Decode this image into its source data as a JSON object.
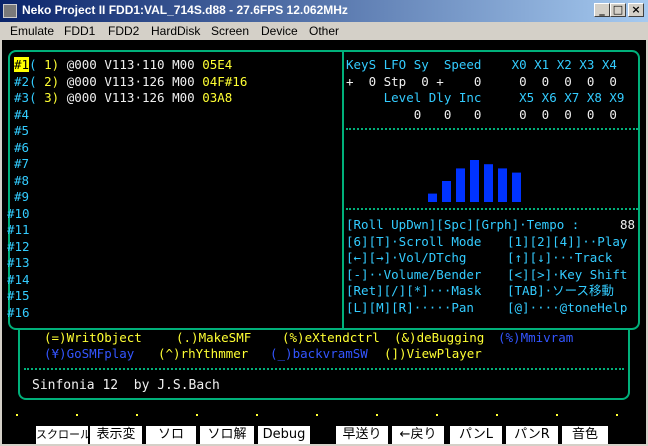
{
  "window": {
    "title": "Neko Project II  FDD1:VAL_714S.d88 - 27.6FPS 12.062MHz",
    "minimize": "_",
    "maximize": "□",
    "close": "×"
  },
  "menu": [
    "Emulate",
    "FDD1",
    "FDD2",
    "HardDisk",
    "Screen",
    "Device",
    "Other"
  ],
  "channels": [
    {
      "id": "#1",
      "paren": "(",
      "num": "1)",
      "info": "@000 V113·110 M00",
      "note": "05E4"
    },
    {
      "id": "#2",
      "paren": "(",
      "num": "2)",
      "info": "@000 V113·126 M00",
      "note": "04F#16"
    },
    {
      "id": "#3",
      "paren": "(",
      "num": "3)",
      "info": "@000 V113·126 M00",
      "note": "03A8"
    },
    {
      "id": "#4"
    },
    {
      "id": "#5"
    },
    {
      "id": "#6"
    },
    {
      "id": "#7"
    },
    {
      "id": "#8"
    },
    {
      "id": "#9"
    },
    {
      "id": "#10"
    },
    {
      "id": "#11"
    },
    {
      "id": "#12"
    },
    {
      "id": "#13"
    },
    {
      "id": "#14"
    },
    {
      "id": "#15"
    },
    {
      "id": "#16"
    }
  ],
  "params": {
    "row1_labels": "KeyS LFO Sy  Speed    X0 X1 X2 X3 X4",
    "row1_values": "+  0 Stp  0 +    0     0  0  0  0  0",
    "row2_labels": "     Level Dly Inc     X5 X6 X7 X8 X9",
    "row2_values": "         0   0   0     0  0  0  0  0"
  },
  "spectrum": [
    2,
    5,
    8,
    10,
    9,
    8,
    7,
    5
  ],
  "help": [
    {
      "key": "[Roll UpDwn][Spc][Grph]·Tempo :",
      "val": "88"
    },
    {
      "key": "[6][T]·Scroll Mode",
      "val": "[1][2][4]]··Play"
    },
    {
      "key": "[←][→]·Vol/DTchg",
      "val": "[↑][↓]···Track"
    },
    {
      "key": "[-]··Volume/Bender",
      "val": "[<][>]·Key Shift"
    },
    {
      "key": "[Ret][/][*]···Mask",
      "val": "[TAB]·ソース移動"
    },
    {
      "key": "[L][M][R]·····Pan",
      "val": "[@]····@toneHelp"
    }
  ],
  "commands": {
    "row1": [
      {
        "text": "(=)WritObject",
        "color": "#ffff33"
      },
      {
        "text": "(.)MakeSMF",
        "color": "#ffff33"
      },
      {
        "text": "(%)eXtendctrl",
        "color": "#ffff33"
      },
      {
        "text": "(&)deBugging",
        "color": "#ffff33"
      },
      {
        "text": "(%)Mmivram",
        "color": "#3355ff"
      }
    ],
    "row2": [
      {
        "text": "(¥)GoSMFplay",
        "color": "#3355ff"
      },
      {
        "text": "(^)rhYthmmer",
        "color": "#ffff33"
      },
      {
        "text": "(_)backvramSW",
        "color": "#3355ff"
      },
      {
        "text": "(])ViewPlayer",
        "color": "#ffff33"
      }
    ]
  },
  "song_title": "Sinfonia 12  by J.S.Bach",
  "fkeys": [
    "スクロール",
    "表示変",
    "ソロ",
    "ソロ解",
    "Debug",
    "早送り",
    "←戻り",
    "パンL",
    "パンR",
    "音色"
  ]
}
